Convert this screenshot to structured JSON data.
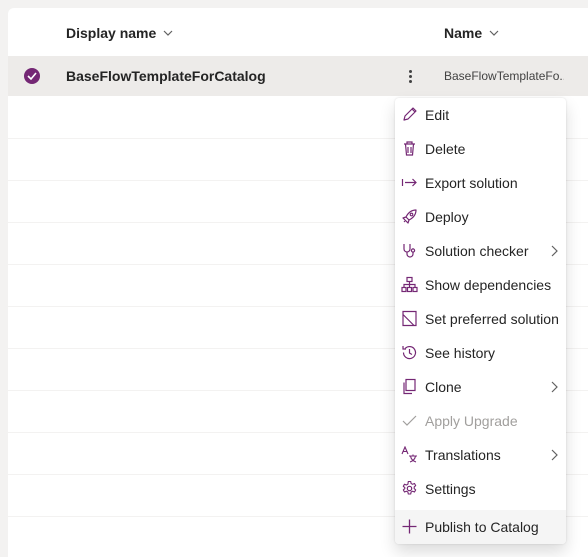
{
  "columns": {
    "display_name": "Display name",
    "name": "Name"
  },
  "selected_row": {
    "display_name": "BaseFlowTemplateForCatalog",
    "name": "BaseFlowTemplateFo..."
  },
  "context_menu": {
    "items": [
      {
        "label": "Edit",
        "icon": "pencil-icon"
      },
      {
        "label": "Delete",
        "icon": "trash-icon"
      },
      {
        "label": "Export solution",
        "icon": "export-arrow-icon"
      },
      {
        "label": "Deploy",
        "icon": "rocket-icon"
      },
      {
        "label": "Solution checker",
        "icon": "stethoscope-icon",
        "submenu": true
      },
      {
        "label": "Show dependencies",
        "icon": "hierarchy-icon"
      },
      {
        "label": "Set preferred solution",
        "icon": "document-icon"
      },
      {
        "label": "See history",
        "icon": "history-icon"
      },
      {
        "label": "Clone",
        "icon": "copy-icon",
        "submenu": true
      },
      {
        "label": "Apply Upgrade",
        "icon": "checkmark-icon",
        "disabled": true
      },
      {
        "label": "Translations",
        "icon": "translate-icon",
        "submenu": true
      },
      {
        "label": "Settings",
        "icon": "gear-icon"
      },
      {
        "label": "Publish to Catalog",
        "icon": "plus-icon"
      }
    ]
  },
  "colors": {
    "accent": "#742774",
    "selected_row_bg": "#edebe9",
    "disabled_text": "#a19f9d"
  }
}
